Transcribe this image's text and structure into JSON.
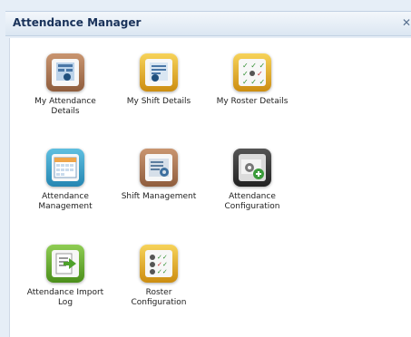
{
  "window": {
    "title": "Attendance Manager",
    "close_glyph": "✕"
  },
  "tiles": [
    {
      "label": "My Attendance Details",
      "icon": "attendance-report-icon"
    },
    {
      "label": "My Shift Details",
      "icon": "shift-report-icon"
    },
    {
      "label": "My Roster Details",
      "icon": "roster-checklist-icon"
    },
    {
      "label": "Attendance Management",
      "icon": "calendar-icon"
    },
    {
      "label": "Shift Management",
      "icon": "shift-settings-icon"
    },
    {
      "label": "Attendance Configuration",
      "icon": "configuration-icon"
    },
    {
      "label": "Attendance Import Log",
      "icon": "import-log-icon"
    },
    {
      "label": "Roster Configuration",
      "icon": "roster-config-icon"
    }
  ]
}
